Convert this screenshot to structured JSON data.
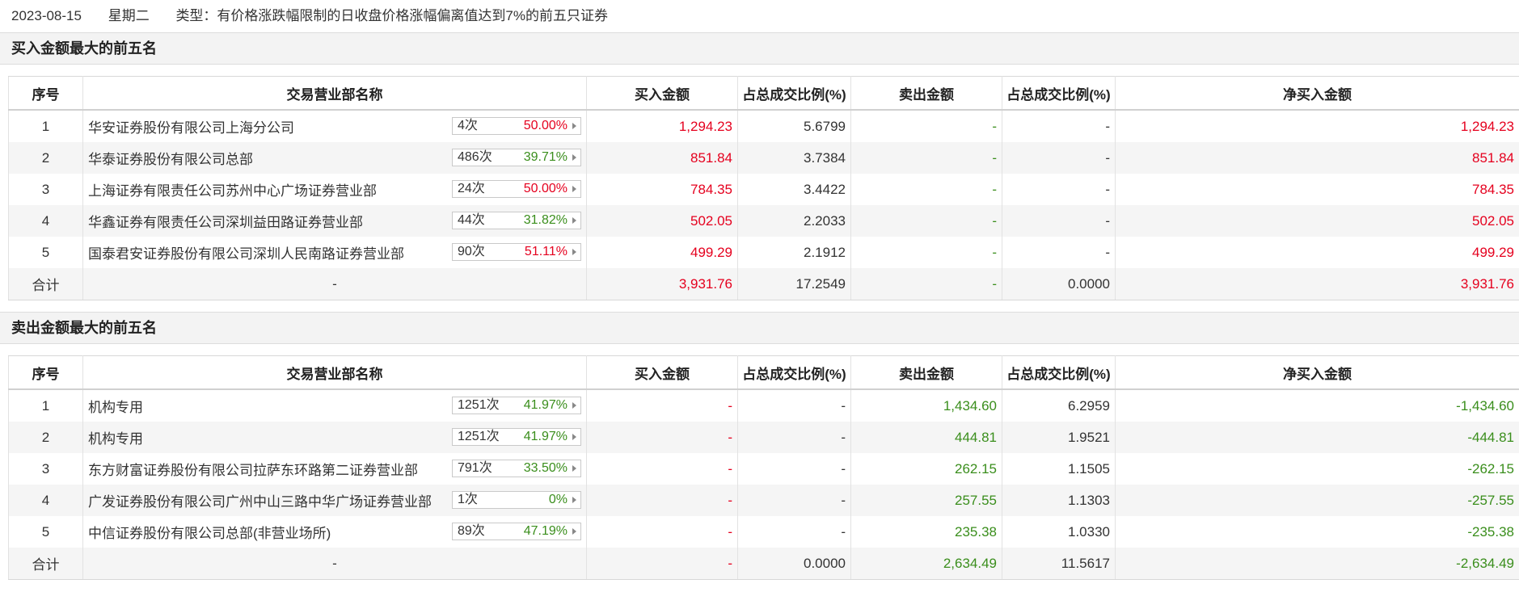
{
  "header": {
    "date": "2023-08-15",
    "weekday": "星期二",
    "type": "类型：有价格涨跌幅限制的日收盘价格涨幅偏离值达到7%的前五只证券"
  },
  "columns": [
    "序号",
    "交易营业部名称",
    "买入金额",
    "占总成交比例(%)",
    "卖出金额",
    "占总成交比例(%)",
    "净买入金额"
  ],
  "colors": {
    "red": "#e5001e",
    "green": "#3a8e1c"
  },
  "buy": {
    "title": "买入金额最大的前五名",
    "rows": [
      {
        "idx": "1",
        "name": "华安证券股份有限公司上海分公司",
        "count": "4次",
        "pct": "50.00%",
        "pct_color": "red",
        "buy": "1,294.23",
        "buy_ratio": "5.6799",
        "sell": "-",
        "sell_ratio": "-",
        "net": "1,294.23"
      },
      {
        "idx": "2",
        "name": "华泰证券股份有限公司总部",
        "count": "486次",
        "pct": "39.71%",
        "pct_color": "green",
        "buy": "851.84",
        "buy_ratio": "3.7384",
        "sell": "-",
        "sell_ratio": "-",
        "net": "851.84"
      },
      {
        "idx": "3",
        "name": "上海证券有限责任公司苏州中心广场证券营业部",
        "count": "24次",
        "pct": "50.00%",
        "pct_color": "red",
        "buy": "784.35",
        "buy_ratio": "3.4422",
        "sell": "-",
        "sell_ratio": "-",
        "net": "784.35"
      },
      {
        "idx": "4",
        "name": "华鑫证券有限责任公司深圳益田路证券营业部",
        "count": "44次",
        "pct": "31.82%",
        "pct_color": "green",
        "buy": "502.05",
        "buy_ratio": "2.2033",
        "sell": "-",
        "sell_ratio": "-",
        "net": "502.05"
      },
      {
        "idx": "5",
        "name": "国泰君安证券股份有限公司深圳人民南路证券营业部",
        "count": "90次",
        "pct": "51.11%",
        "pct_color": "red",
        "buy": "499.29",
        "buy_ratio": "2.1912",
        "sell": "-",
        "sell_ratio": "-",
        "net": "499.29"
      }
    ],
    "total": {
      "label": "合计",
      "name": "-",
      "buy": "3,931.76",
      "buy_ratio": "17.2549",
      "sell": "-",
      "sell_ratio": "0.0000",
      "net": "3,931.76"
    }
  },
  "sell": {
    "title": "卖出金额最大的前五名",
    "rows": [
      {
        "idx": "1",
        "name": "机构专用",
        "count": "1251次",
        "pct": "41.97%",
        "pct_color": "green",
        "buy": "-",
        "buy_ratio": "-",
        "sell": "1,434.60",
        "sell_ratio": "6.2959",
        "net": "-1,434.60"
      },
      {
        "idx": "2",
        "name": "机构专用",
        "count": "1251次",
        "pct": "41.97%",
        "pct_color": "green",
        "buy": "-",
        "buy_ratio": "-",
        "sell": "444.81",
        "sell_ratio": "1.9521",
        "net": "-444.81"
      },
      {
        "idx": "3",
        "name": "东方财富证券股份有限公司拉萨东环路第二证券营业部",
        "count": "791次",
        "pct": "33.50%",
        "pct_color": "green",
        "buy": "-",
        "buy_ratio": "-",
        "sell": "262.15",
        "sell_ratio": "1.1505",
        "net": "-262.15"
      },
      {
        "idx": "4",
        "name": "广发证券股份有限公司广州中山三路中华广场证券营业部",
        "count": "1次",
        "pct": "0%",
        "pct_color": "green",
        "buy": "-",
        "buy_ratio": "-",
        "sell": "257.55",
        "sell_ratio": "1.1303",
        "net": "-257.55"
      },
      {
        "idx": "5",
        "name": "中信证券股份有限公司总部(非营业场所)",
        "count": "89次",
        "pct": "47.19%",
        "pct_color": "green",
        "buy": "-",
        "buy_ratio": "-",
        "sell": "235.38",
        "sell_ratio": "1.0330",
        "net": "-235.38"
      }
    ],
    "total": {
      "label": "合计",
      "name": "-",
      "buy": "-",
      "buy_ratio": "0.0000",
      "sell": "2,634.49",
      "sell_ratio": "11.5617",
      "net": "-2,634.49"
    }
  }
}
